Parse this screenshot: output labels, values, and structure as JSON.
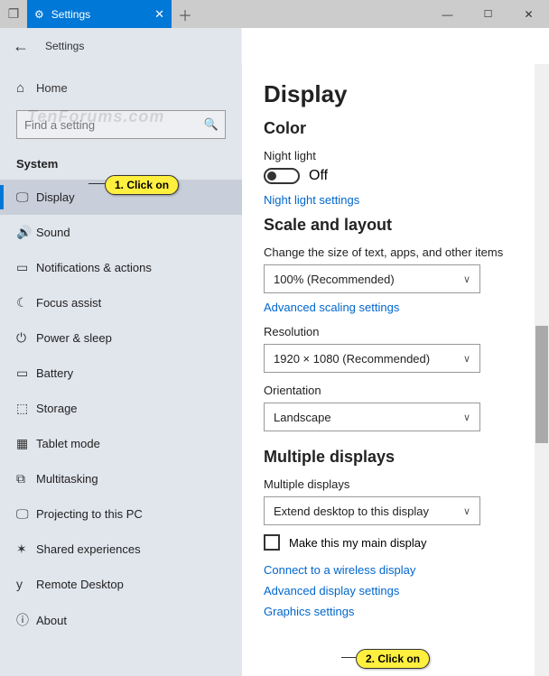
{
  "titlebar": {
    "tab_label": "Settings",
    "app_title": "Settings"
  },
  "watermark": "TenForums.com",
  "sidebar": {
    "home_label": "Home",
    "search_placeholder": "Find a setting",
    "section_label": "System",
    "items": [
      {
        "label": "Display",
        "icon": "🖵",
        "selected": true
      },
      {
        "label": "Sound",
        "icon": "🔊"
      },
      {
        "label": "Notifications & actions",
        "icon": "▭"
      },
      {
        "label": "Focus assist",
        "icon": "☾"
      },
      {
        "label": "Power & sleep",
        "icon": "⏻"
      },
      {
        "label": "Battery",
        "icon": "▭"
      },
      {
        "label": "Storage",
        "icon": "⬚"
      },
      {
        "label": "Tablet mode",
        "icon": "▦"
      },
      {
        "label": "Multitasking",
        "icon": "⧉"
      },
      {
        "label": "Projecting to this PC",
        "icon": "🖵"
      },
      {
        "label": "Shared experiences",
        "icon": "✶"
      },
      {
        "label": "Remote Desktop",
        "icon": "y"
      },
      {
        "label": "About",
        "icon": "ⓘ"
      }
    ]
  },
  "content": {
    "title": "Display",
    "color_heading": "Color",
    "night_light_label": "Night light",
    "night_light_state": "Off",
    "night_light_link": "Night light settings",
    "scale_heading": "Scale and layout",
    "text_size_label": "Change the size of text, apps, and other items",
    "text_size_value": "100% (Recommended)",
    "adv_scaling_link": "Advanced scaling settings",
    "resolution_label": "Resolution",
    "resolution_value": "1920 × 1080 (Recommended)",
    "orientation_label": "Orientation",
    "orientation_value": "Landscape",
    "multi_heading": "Multiple displays",
    "multi_label": "Multiple displays",
    "multi_value": "Extend desktop to this display",
    "main_display_label": "Make this my main display",
    "connect_link": "Connect to a wireless display",
    "adv_display_link": "Advanced display settings",
    "graphics_link": "Graphics settings"
  },
  "callouts": {
    "c1": "1. Click on",
    "c2": "2. Click on"
  }
}
